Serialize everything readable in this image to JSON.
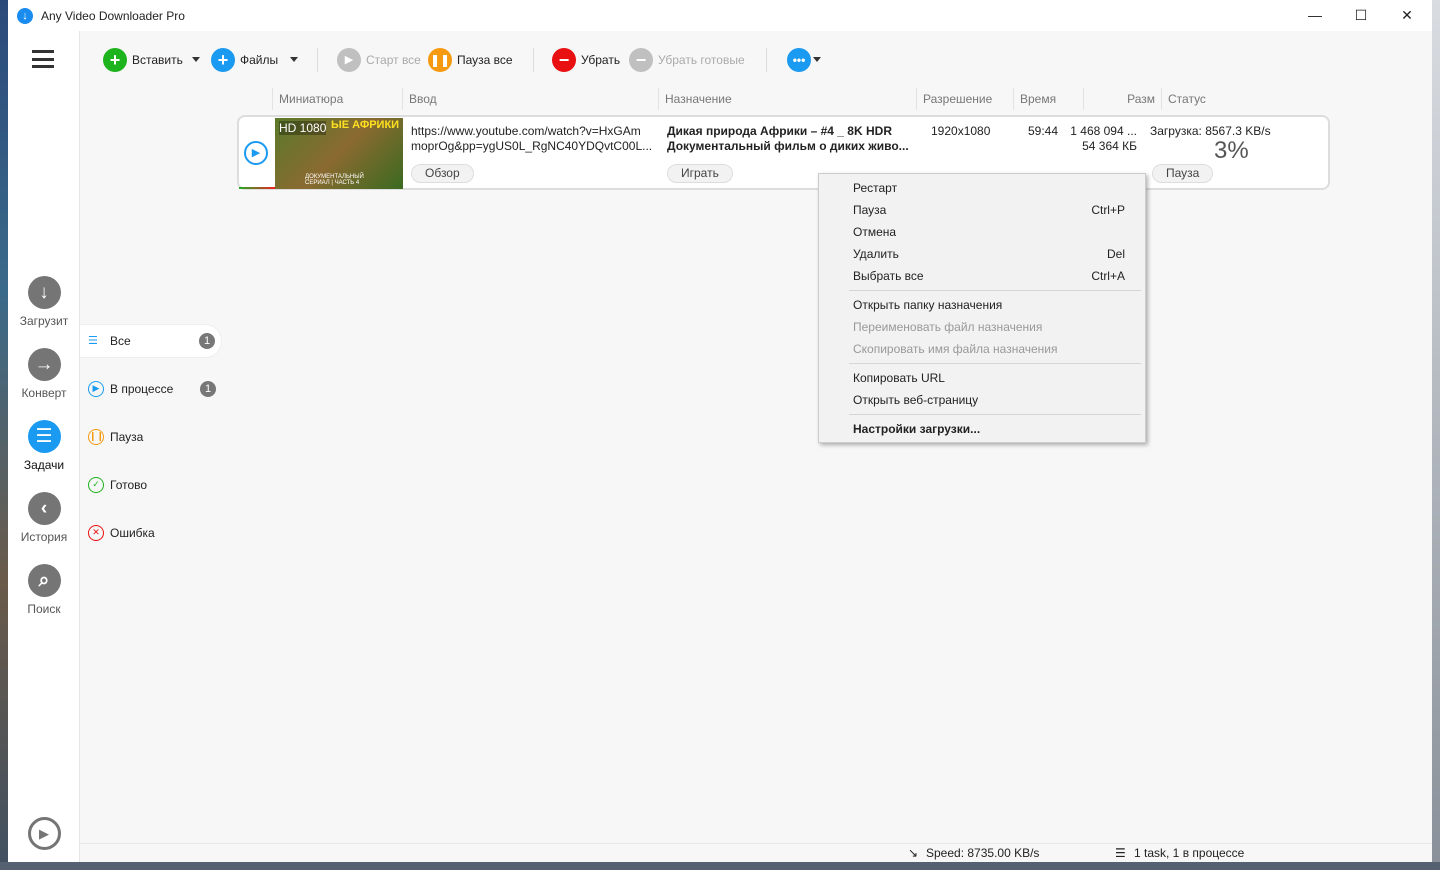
{
  "window": {
    "title": "Any Video Downloader Pro",
    "minimize": "—",
    "maximize": "☐",
    "close": "✕"
  },
  "toolbar": {
    "paste": "Вставить",
    "files": "Файлы",
    "start_all": "Старт все",
    "pause_all": "Пауза все",
    "remove": "Убрать",
    "remove_done": "Убрать готовые",
    "colors": {
      "green": "#1db31d",
      "blue": "#1a9af0",
      "orange": "#f59a10",
      "red": "#e81010",
      "gray": "#c0c0c0"
    }
  },
  "nav": [
    {
      "label": "Загрузит",
      "icon": "↓"
    },
    {
      "label": "Конверт",
      "icon": "→"
    },
    {
      "label": "Задачи",
      "icon": "☰"
    },
    {
      "label": "История",
      "icon": "‹"
    },
    {
      "label": "Поиск",
      "icon": "⌕"
    }
  ],
  "columns": [
    "Миниатюра",
    "Ввод",
    "Назначение",
    "Разрешение",
    "Время",
    "Разм",
    "Статус"
  ],
  "task": {
    "thumb_label": "HD 1080",
    "thumb_title": "ЫЕ АФРИКИ",
    "thumb_caption": "ДОКУМЕНТАЛЬНЫЙ СЕРИАЛ | ЧАСТЬ 4",
    "url1": "https://www.youtube.com/watch?v=HxGAm",
    "url2": "moprOg&pp=ygUS0L_RgNC40YDQvtC00L...",
    "browse": "Обзор",
    "dest1": "Дикая природа Африки – #4 _ 8K HDR",
    "dest2": "Документальный фильм о диких живо...",
    "play": "Играть",
    "resolution": "1920x1080",
    "time": "59:44",
    "size1": "1 468 094 ...",
    "size2": "54 364 КБ",
    "status": "Загрузка: 8567.3 KB/s",
    "percent": "3%",
    "progress": 0.03,
    "pause": "Пауза"
  },
  "filters": [
    {
      "label": "Все",
      "count": "1"
    },
    {
      "label": "В процессе",
      "count": "1"
    },
    {
      "label": "Пауза"
    },
    {
      "label": "Готово"
    },
    {
      "label": "Ошибка"
    }
  ],
  "menu": [
    {
      "label": "Рестарт",
      "key": ""
    },
    {
      "label": "Пауза",
      "key": "Ctrl+P"
    },
    {
      "label": "Отмена",
      "key": ""
    },
    {
      "label": "Удалить",
      "key": "Del"
    },
    {
      "label": "Выбрать все",
      "key": "Ctrl+A"
    },
    {
      "label": "Открыть папку назначения",
      "key": ""
    },
    {
      "label": "Переименовать файл назначения",
      "key": ""
    },
    {
      "label": "Скопировать имя файла назначения",
      "key": ""
    },
    {
      "label": "Копировать URL",
      "key": ""
    },
    {
      "label": "Открыть веб-страницу",
      "key": ""
    },
    {
      "label": "Настройки загрузки...",
      "key": ""
    }
  ],
  "statusbar": {
    "speed": "Speed: 8735.00 KB/s",
    "tasks": "1 task, 1 в процессе"
  }
}
